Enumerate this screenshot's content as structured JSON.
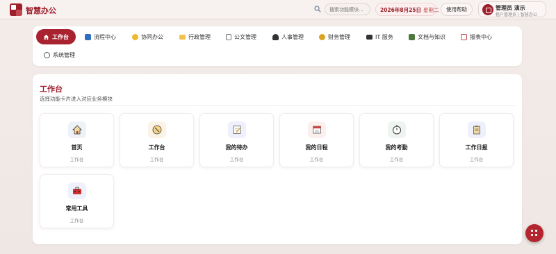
{
  "app": {
    "title": "智慧办公"
  },
  "header": {
    "search_placeholder": "搜索功能模块...",
    "date": "2026年8月25日",
    "weekday": "星期二",
    "help_label": "使用帮助",
    "user_name": "管理员 演示",
    "user_role": "租户管理员 | 智慧办公"
  },
  "nav": {
    "items": [
      {
        "label": "工作台",
        "icon": "home-icon",
        "active": true
      },
      {
        "label": "流程中心",
        "icon": "workflow-icon"
      },
      {
        "label": "协同办公",
        "icon": "handshake-icon"
      },
      {
        "label": "行政管理",
        "icon": "folder-icon"
      },
      {
        "label": "公文管理",
        "icon": "document-icon"
      },
      {
        "label": "人事管理",
        "icon": "people-icon"
      },
      {
        "label": "财务管理",
        "icon": "money-bag-icon"
      },
      {
        "label": "IT 服务",
        "icon": "monitor-icon"
      },
      {
        "label": "文档与知识",
        "icon": "book-icon"
      },
      {
        "label": "报表中心",
        "icon": "chart-icon"
      },
      {
        "label": "系统管理",
        "icon": "gear-icon"
      }
    ]
  },
  "main": {
    "title": "工作台",
    "subtitle": "选择功能卡片进入对应业务模块",
    "cards": [
      {
        "title": "首页",
        "sub": "工作台",
        "icon": "house-icon"
      },
      {
        "title": "工作台",
        "sub": "工作台",
        "icon": "compass-icon"
      },
      {
        "title": "我的待办",
        "sub": "工作台",
        "icon": "memo-icon"
      },
      {
        "title": "我的日程",
        "sub": "工作台",
        "icon": "calendar-icon"
      },
      {
        "title": "我的考勤",
        "sub": "工作台",
        "icon": "stopwatch-icon"
      },
      {
        "title": "工作日报",
        "sub": "工作台",
        "icon": "clipboard-icon"
      },
      {
        "title": "常用工具",
        "sub": "工作台",
        "icon": "toolbox-icon"
      }
    ]
  },
  "colors": {
    "accent": "#9e1f2b",
    "fab": "#b3262f"
  }
}
